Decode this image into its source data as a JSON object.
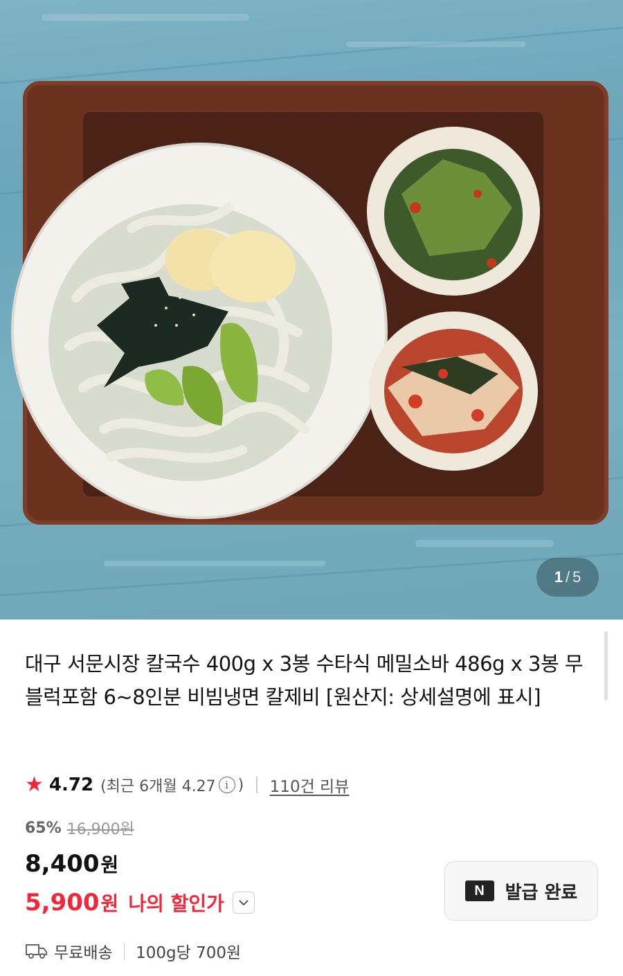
{
  "gallery": {
    "current": "1",
    "separator": "/",
    "total": "5"
  },
  "product": {
    "title": "대구 서문시장 칼국수 400g x 3봉 수타식 메밀소바 486g x 3봉 무블럭포함 6~8인분 비빔냉면 칼제비 [원산지: 상세설명에 표시]",
    "rating": {
      "star_icon": "star-icon",
      "score": "4.72",
      "recent_open": "(최근 6개월 4.27",
      "recent_close": ")",
      "review_link": "110건 리뷰"
    },
    "pricing": {
      "discount_rate": "65%",
      "original_price": "16,900원",
      "price_number": "8,400",
      "price_unit": "원",
      "my_price_number": "5,900",
      "my_price_unit": "원",
      "my_price_label": "나의 할인가"
    },
    "coupon": {
      "icon_text": "N",
      "label": "발급 완료"
    },
    "shipping": {
      "label": "무료배송",
      "unit_price": "100g당 700원"
    }
  },
  "colors": {
    "accent_red": "#f0283c",
    "wood": "#5a2a1c",
    "table_blue": "#7fb2c4"
  }
}
